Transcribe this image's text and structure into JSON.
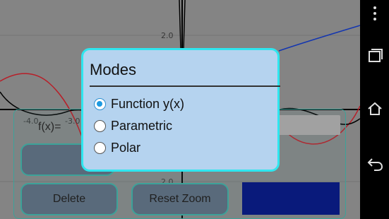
{
  "graph": {
    "y_tick_labels": [
      "2.0",
      "2.0"
    ],
    "x_tick_labels": [
      "-4.0",
      "-3.0"
    ],
    "curve_colors": {
      "red": "#c0202a",
      "blue": "#1438b8",
      "axis": "#000000"
    }
  },
  "panel": {
    "fx_label": "f(x)=",
    "delete_label": "Delete",
    "reset_zoom_label": "Reset Zoom",
    "swatch_color": "#0a1c80"
  },
  "dialog": {
    "title": "Modes",
    "options": [
      {
        "label": "Function y(x)",
        "selected": true
      },
      {
        "label": "Parametric",
        "selected": false
      },
      {
        "label": "Polar",
        "selected": false
      }
    ]
  },
  "navbar": {
    "icons": [
      "menu-icon",
      "recent-apps-icon",
      "home-icon",
      "back-icon"
    ]
  }
}
